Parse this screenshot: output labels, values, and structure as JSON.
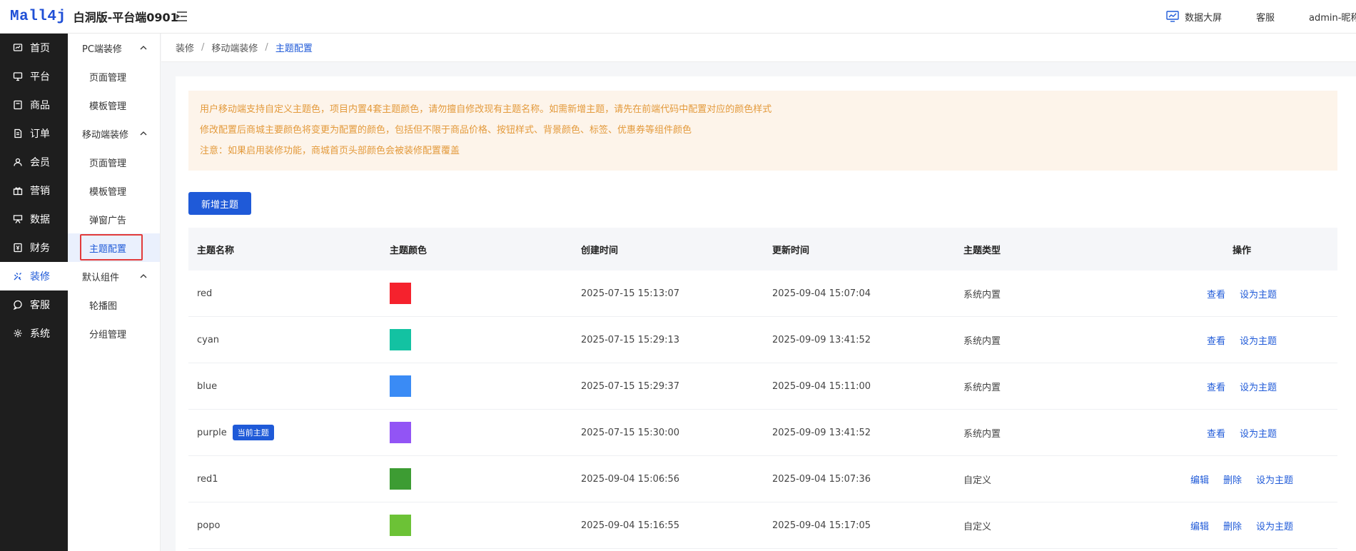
{
  "header": {
    "logo_text": "Mall4j",
    "app_title": "白洞版-平台端0901",
    "screen_label": "数据大屏",
    "service_label": "客服",
    "user_label": "admin-昵称"
  },
  "sidebar": {
    "items": [
      {
        "label": "首页",
        "icon": "monitor-icon"
      },
      {
        "label": "平台",
        "icon": "desktop-icon"
      },
      {
        "label": "商品",
        "icon": "product-icon"
      },
      {
        "label": "订单",
        "icon": "order-icon"
      },
      {
        "label": "会员",
        "icon": "member-icon"
      },
      {
        "label": "营销",
        "icon": "gift-icon"
      },
      {
        "label": "数据",
        "icon": "data-icon"
      },
      {
        "label": "财务",
        "icon": "finance-icon"
      },
      {
        "label": "装修",
        "icon": "decorate-icon"
      },
      {
        "label": "客服",
        "icon": "chat-icon"
      },
      {
        "label": "系统",
        "icon": "gear-icon"
      }
    ],
    "active_index": 8
  },
  "submenu": {
    "groups": [
      {
        "label": "PC端装修",
        "items": [
          "页面管理",
          "模板管理"
        ]
      },
      {
        "label": "移动端装修",
        "items": [
          "页面管理",
          "模板管理",
          "弹窗广告",
          "主题配置"
        ]
      },
      {
        "label": "默认组件",
        "items": [
          "轮播图",
          "分组管理"
        ]
      }
    ],
    "active": "主题配置"
  },
  "breadcrumb": [
    "装修",
    "移动端装修",
    "主题配置"
  ],
  "notice": {
    "lines": [
      "用户移动端支持自定义主题色，项目内置4套主题颜色，请勿擅自修改现有主题名称。如需新增主题，请先在前端代码中配置对应的颜色样式",
      "修改配置后商城主要颜色将变更为配置的颜色，包括但不限于商品价格、按钮样式、背景颜色、标签、优惠券等组件颜色",
      "注意：如果启用装修功能，商城首页头部颜色会被装修配置覆盖"
    ]
  },
  "add_button_label": "新增主题",
  "table": {
    "columns": [
      "主题名称",
      "主题颜色",
      "创建时间",
      "更新时间",
      "主题类型",
      "操作"
    ],
    "current_badge": "当前主题",
    "rows": [
      {
        "name": "red",
        "color": "#f5222d",
        "created": "2025-07-15 15:13:07",
        "updated": "2025-09-04 15:07:04",
        "type": "系统内置",
        "current": false,
        "actions": [
          "查看",
          "设为主题"
        ]
      },
      {
        "name": "cyan",
        "color": "#13c2a2",
        "created": "2025-07-15 15:29:13",
        "updated": "2025-09-09 13:41:52",
        "type": "系统内置",
        "current": false,
        "actions": [
          "查看",
          "设为主题"
        ]
      },
      {
        "name": "blue",
        "color": "#3a8bf5",
        "created": "2025-07-15 15:29:37",
        "updated": "2025-09-04 15:11:00",
        "type": "系统内置",
        "current": false,
        "actions": [
          "查看",
          "设为主题"
        ]
      },
      {
        "name": "purple",
        "color": "#9254f5",
        "created": "2025-07-15 15:30:00",
        "updated": "2025-09-09 13:41:52",
        "type": "系统内置",
        "current": true,
        "actions": [
          "查看",
          "设为主题"
        ]
      },
      {
        "name": "red1",
        "color": "#3d9c33",
        "created": "2025-09-04 15:06:56",
        "updated": "2025-09-04 15:07:36",
        "type": "自定义",
        "current": false,
        "actions": [
          "编辑",
          "删除",
          "设为主题"
        ]
      },
      {
        "name": "popo",
        "color": "#6cc236",
        "created": "2025-09-04 15:16:55",
        "updated": "2025-09-04 15:17:05",
        "type": "自定义",
        "current": false,
        "actions": [
          "编辑",
          "删除",
          "设为主题"
        ]
      }
    ]
  }
}
